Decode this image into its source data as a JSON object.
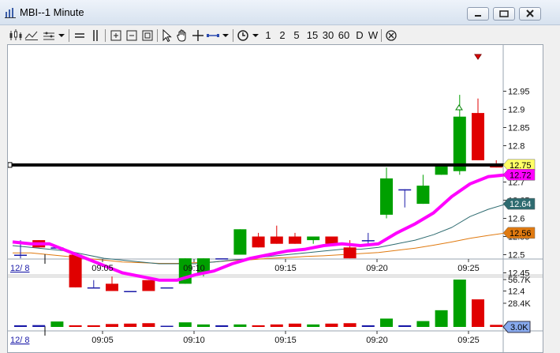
{
  "window": {
    "title": "MBI--1 Minute"
  },
  "toolbar": {
    "intervals": [
      {
        "label": "1"
      },
      {
        "label": "2"
      },
      {
        "label": "5"
      },
      {
        "label": "15"
      },
      {
        "label": "30"
      },
      {
        "label": "60"
      },
      {
        "label": "D"
      },
      {
        "label": "W"
      }
    ]
  },
  "colors": {
    "up": "#00a000",
    "down": "#e00000",
    "ema_fast": "#ff00ff",
    "ema_mid": "#2e6b70",
    "ema_slow": "#e07a10",
    "volume_tag": "#88aaee",
    "horizontal_line": "#000000"
  },
  "chart_data": {
    "type": "candlestick",
    "symbol": "MBI",
    "interval": "1 Minute",
    "date_label": "12/ 8",
    "time_ticks": [
      "09:05",
      "09:10",
      "09:15",
      "09:20",
      "09:25"
    ],
    "y_ticks": [
      "12.95",
      "12.9",
      "12.85",
      "12.8",
      "12.75",
      "12.7",
      "12.65",
      "12.6",
      "12.55",
      "12.5",
      "12.45",
      "12.4"
    ],
    "ylim": [
      12.39,
      12.96
    ],
    "horizontal_line_price": 12.747,
    "price_tags": [
      {
        "label": "12.75",
        "color": "#ffff66"
      },
      {
        "label": "12.72",
        "color": "#ff00ff"
      },
      {
        "label": "12.64",
        "color": "#2e6b70"
      },
      {
        "label": "12.56",
        "color": "#e07a10"
      }
    ],
    "candles": [
      {
        "o": 12.5,
        "h": 12.54,
        "l": 12.49,
        "c": 12.5
      },
      {
        "o": 12.54,
        "h": 12.54,
        "l": 12.52,
        "c": 12.52
      },
      {
        "o": 12.52,
        "h": 12.52,
        "l": 12.52,
        "c": 12.52
      },
      {
        "o": 12.5,
        "h": 12.5,
        "l": 12.41,
        "c": 12.41
      },
      {
        "o": 12.41,
        "h": 12.43,
        "l": 12.41,
        "c": 12.41
      },
      {
        "o": 12.42,
        "h": 12.44,
        "l": 12.4,
        "c": 12.4
      },
      {
        "o": 12.4,
        "h": 12.4,
        "l": 12.4,
        "c": 12.4
      },
      {
        "o": 12.43,
        "h": 12.43,
        "l": 12.4,
        "c": 12.4
      },
      {
        "o": 12.41,
        "h": 12.41,
        "l": 12.41,
        "c": 12.41
      },
      {
        "o": 12.42,
        "h": 12.49,
        "l": 12.42,
        "c": 12.49
      },
      {
        "o": 12.45,
        "h": 12.49,
        "l": 12.44,
        "c": 12.49
      },
      {
        "o": 12.49,
        "h": 12.49,
        "l": 12.49,
        "c": 12.49
      },
      {
        "o": 12.5,
        "h": 12.57,
        "l": 12.5,
        "c": 12.57
      },
      {
        "o": 12.55,
        "h": 12.56,
        "l": 12.52,
        "c": 12.52
      },
      {
        "o": 12.55,
        "h": 12.58,
        "l": 12.53,
        "c": 12.53
      },
      {
        "o": 12.55,
        "h": 12.56,
        "l": 12.53,
        "c": 12.53
      },
      {
        "o": 12.54,
        "h": 12.55,
        "l": 12.53,
        "c": 12.55
      },
      {
        "o": 12.55,
        "h": 12.55,
        "l": 12.53,
        "c": 12.53
      },
      {
        "o": 12.52,
        "h": 12.54,
        "l": 12.49,
        "c": 12.49
      },
      {
        "o": 12.54,
        "h": 12.56,
        "l": 12.53,
        "c": 12.54
      },
      {
        "o": 12.61,
        "h": 12.74,
        "l": 12.6,
        "c": 12.71
      },
      {
        "o": 12.68,
        "h": 12.68,
        "l": 12.63,
        "c": 12.68
      },
      {
        "o": 12.64,
        "h": 12.72,
        "l": 12.64,
        "c": 12.69
      },
      {
        "o": 12.72,
        "h": 12.75,
        "l": 12.72,
        "c": 12.75
      },
      {
        "o": 12.73,
        "h": 12.94,
        "l": 12.72,
        "c": 12.88
      },
      {
        "o": 12.89,
        "h": 12.93,
        "l": 12.76,
        "c": 12.76
      },
      {
        "o": 12.75,
        "h": 12.76,
        "l": 12.74,
        "c": 12.74
      }
    ],
    "ema_fast": [
      12.535,
      12.53,
      12.53,
      12.51,
      12.49,
      12.47,
      12.45,
      12.44,
      12.43,
      12.43,
      12.445,
      12.455,
      12.475,
      12.49,
      12.5,
      12.51,
      12.515,
      12.525,
      12.53,
      12.525,
      12.53,
      12.56,
      12.585,
      12.615,
      12.66,
      12.695,
      12.715,
      12.72
    ],
    "ema_mid": [
      12.525,
      12.52,
      12.515,
      12.51,
      12.5,
      12.49,
      12.485,
      12.48,
      12.475,
      12.475,
      12.475,
      12.48,
      12.485,
      12.49,
      12.495,
      12.5,
      12.505,
      12.51,
      12.515,
      12.515,
      12.52,
      12.53,
      12.54,
      12.555,
      12.575,
      12.605,
      12.625,
      12.64
    ],
    "ema_slow": [
      12.505,
      12.505,
      12.5,
      12.495,
      12.49,
      12.485,
      12.48,
      12.478,
      12.476,
      12.476,
      12.478,
      12.48,
      12.484,
      12.486,
      12.49,
      12.492,
      12.495,
      12.497,
      12.5,
      12.503,
      12.506,
      12.512,
      12.518,
      12.526,
      12.535,
      12.545,
      12.553,
      12.56
    ],
    "volume": {
      "y_ticks": [
        "56.7K",
        "28.4K"
      ],
      "ylim": [
        0,
        56700
      ],
      "current_label": "3.0K",
      "bars": [
        {
          "v": 2000,
          "dir": "flat"
        },
        {
          "v": 2200,
          "dir": "flat"
        },
        {
          "v": 6500,
          "dir": "up"
        },
        {
          "v": 2000,
          "dir": "down"
        },
        {
          "v": 2000,
          "dir": "down"
        },
        {
          "v": 3500,
          "dir": "down"
        },
        {
          "v": 4000,
          "dir": "down"
        },
        {
          "v": 4500,
          "dir": "down"
        },
        {
          "v": 0,
          "dir": "flat"
        },
        {
          "v": 5500,
          "dir": "up"
        },
        {
          "v": 3000,
          "dir": "up"
        },
        {
          "v": 2000,
          "dir": "flat"
        },
        {
          "v": 3000,
          "dir": "up"
        },
        {
          "v": 2000,
          "dir": "down"
        },
        {
          "v": 3000,
          "dir": "down"
        },
        {
          "v": 4000,
          "dir": "down"
        },
        {
          "v": 3000,
          "dir": "up"
        },
        {
          "v": 4000,
          "dir": "down"
        },
        {
          "v": 4500,
          "dir": "down"
        },
        {
          "v": 2000,
          "dir": "flat"
        },
        {
          "v": 10000,
          "dir": "up"
        },
        {
          "v": 2000,
          "dir": "flat"
        },
        {
          "v": 7000,
          "dir": "up"
        },
        {
          "v": 20000,
          "dir": "up"
        },
        {
          "v": 56700,
          "dir": "up"
        },
        {
          "v": 33000,
          "dir": "down"
        },
        {
          "v": 2500,
          "dir": "down"
        }
      ]
    }
  }
}
